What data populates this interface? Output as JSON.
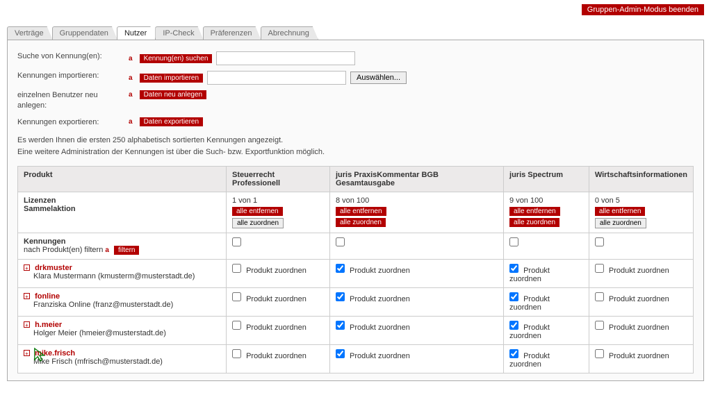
{
  "topbar": {
    "exit_admin": "Gruppen-Admin-Modus beenden"
  },
  "tabs": {
    "items": [
      "Verträge",
      "Gruppendaten",
      "Nutzer",
      "IP-Check",
      "Präferenzen",
      "Abrechnung"
    ],
    "active_index": 2
  },
  "form": {
    "search_label": "Suche von Kennung(en):",
    "search_btn": "Kennung(en) suchen",
    "import_label": "Kennungen importieren:",
    "import_btn": "Daten importieren",
    "choose_btn": "Auswählen...",
    "new_user_label": "einzelnen Benutzer neu anlegen:",
    "new_user_btn": "Daten neu anlegen",
    "export_label": "Kennungen exportieren:",
    "export_btn": "Daten exportieren"
  },
  "info": {
    "line1": "Es werden Ihnen die ersten 250 alphabetisch sortierten Kennungen angezeigt.",
    "line2": "Eine weitere Administration der Kennungen ist über die Such- bzw. Exportfunktion möglich."
  },
  "table": {
    "product_header": "Produkt",
    "products": [
      {
        "name": "Steuerrecht Professionell",
        "licenses": "1 von 1"
      },
      {
        "name": "juris PraxisKommentar BGB Gesamtausgabe",
        "licenses": "8 von 100"
      },
      {
        "name": "juris Spectrum",
        "licenses": "9 von 100"
      },
      {
        "name": "Wirtschaftsinformationen",
        "licenses": "0 von 5"
      }
    ],
    "licenses_label": "Lizenzen",
    "bulk_label": "Sammelaktion",
    "remove_all": "alle entfernen",
    "assign_all": "alle zuordnen",
    "kennungen_label": "Kennungen",
    "filter_label": "nach Produkt(en) filtern",
    "filter_btn": "filtern",
    "assign_label": "Produkt zuordnen",
    "users": [
      {
        "login": "drkmuster",
        "detail": "Klara Mustermann (kmusterm@musterstadt.de)",
        "checks": [
          false,
          true,
          true,
          false
        ]
      },
      {
        "login": "fonline",
        "detail": "Franziska Online (franz@musterstadt.de)",
        "checks": [
          false,
          true,
          true,
          false
        ]
      },
      {
        "login": "h.meier",
        "detail": "Holger Meier (hmeier@musterstadt.de)",
        "checks": [
          false,
          true,
          true,
          false
        ]
      },
      {
        "login": "mike.frisch",
        "detail": "Mike Frisch (mfrisch@musterstadt.de)",
        "checks": [
          false,
          true,
          true,
          false
        ]
      }
    ]
  }
}
